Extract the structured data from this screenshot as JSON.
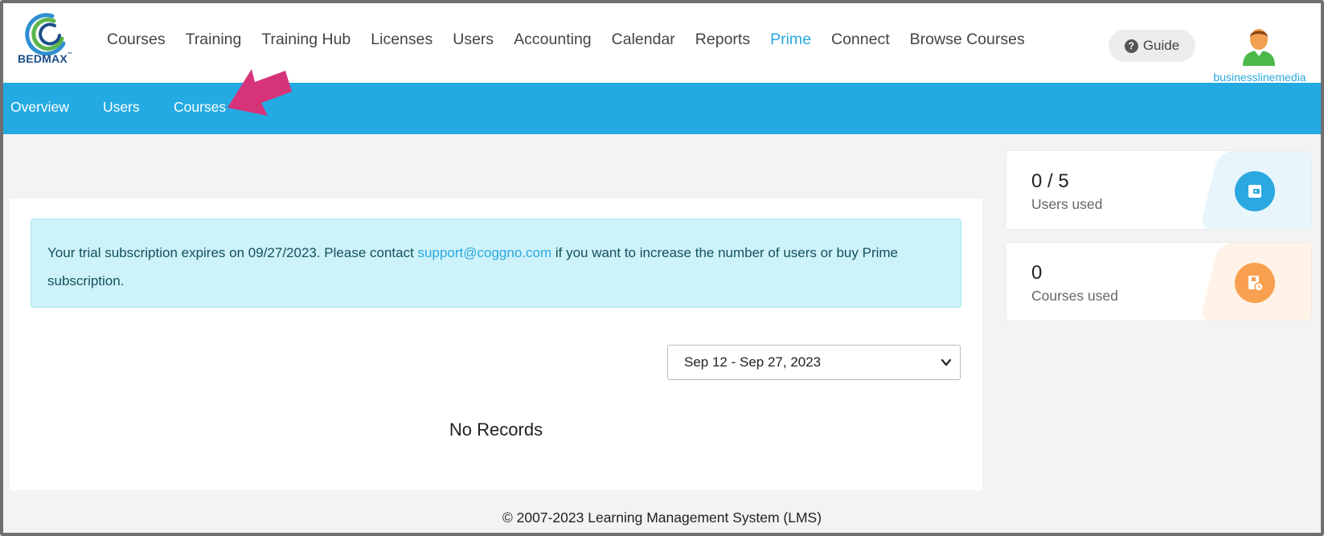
{
  "header": {
    "logo_text": "BEDMAX",
    "logo_mark": "™",
    "nav": [
      {
        "label": "Courses"
      },
      {
        "label": "Training"
      },
      {
        "label": "Training Hub"
      },
      {
        "label": "Licenses"
      },
      {
        "label": "Users"
      },
      {
        "label": "Accounting"
      },
      {
        "label": "Calendar"
      },
      {
        "label": "Reports"
      },
      {
        "label": "Prime",
        "active": true
      },
      {
        "label": "Connect"
      },
      {
        "label": "Browse Courses"
      }
    ],
    "guide_label": "Guide",
    "guide_icon": "question-circle-icon",
    "avatar_icon": "user-avatar-icon",
    "username": "businesslinemedia"
  },
  "subnav": {
    "items": [
      {
        "label": "Overview"
      },
      {
        "label": "Users"
      },
      {
        "label": "Courses"
      }
    ],
    "annotation_icon": "pointer-arrow-icon"
  },
  "alert": {
    "text_before": "Your trial subscription expires on 09/27/2023. Please contact ",
    "email": "support@coggno.com",
    "text_after": " if you want to increase the number of users or buy Prime subscription."
  },
  "date_range": {
    "selected": "Sep 12 - Sep 27, 2023"
  },
  "empty_state": "No Records",
  "stats": [
    {
      "value": "0 / 5",
      "label": "Users used",
      "icon": "wallet-icon",
      "accent": "#2ba8e0",
      "tint": "#e8f6fc"
    },
    {
      "value": "0",
      "label": "Courses used",
      "icon": "course-clock-icon",
      "accent": "#f9a050",
      "tint": "#fff2e6"
    }
  ],
  "footer": "© 2007-2023 Learning Management System (LMS)",
  "colors": {
    "brand_blue": "#24aae2",
    "active_link": "#2ba8e0",
    "alert_bg": "#cdf2f9",
    "annotation_arrow": "#d6337a"
  }
}
